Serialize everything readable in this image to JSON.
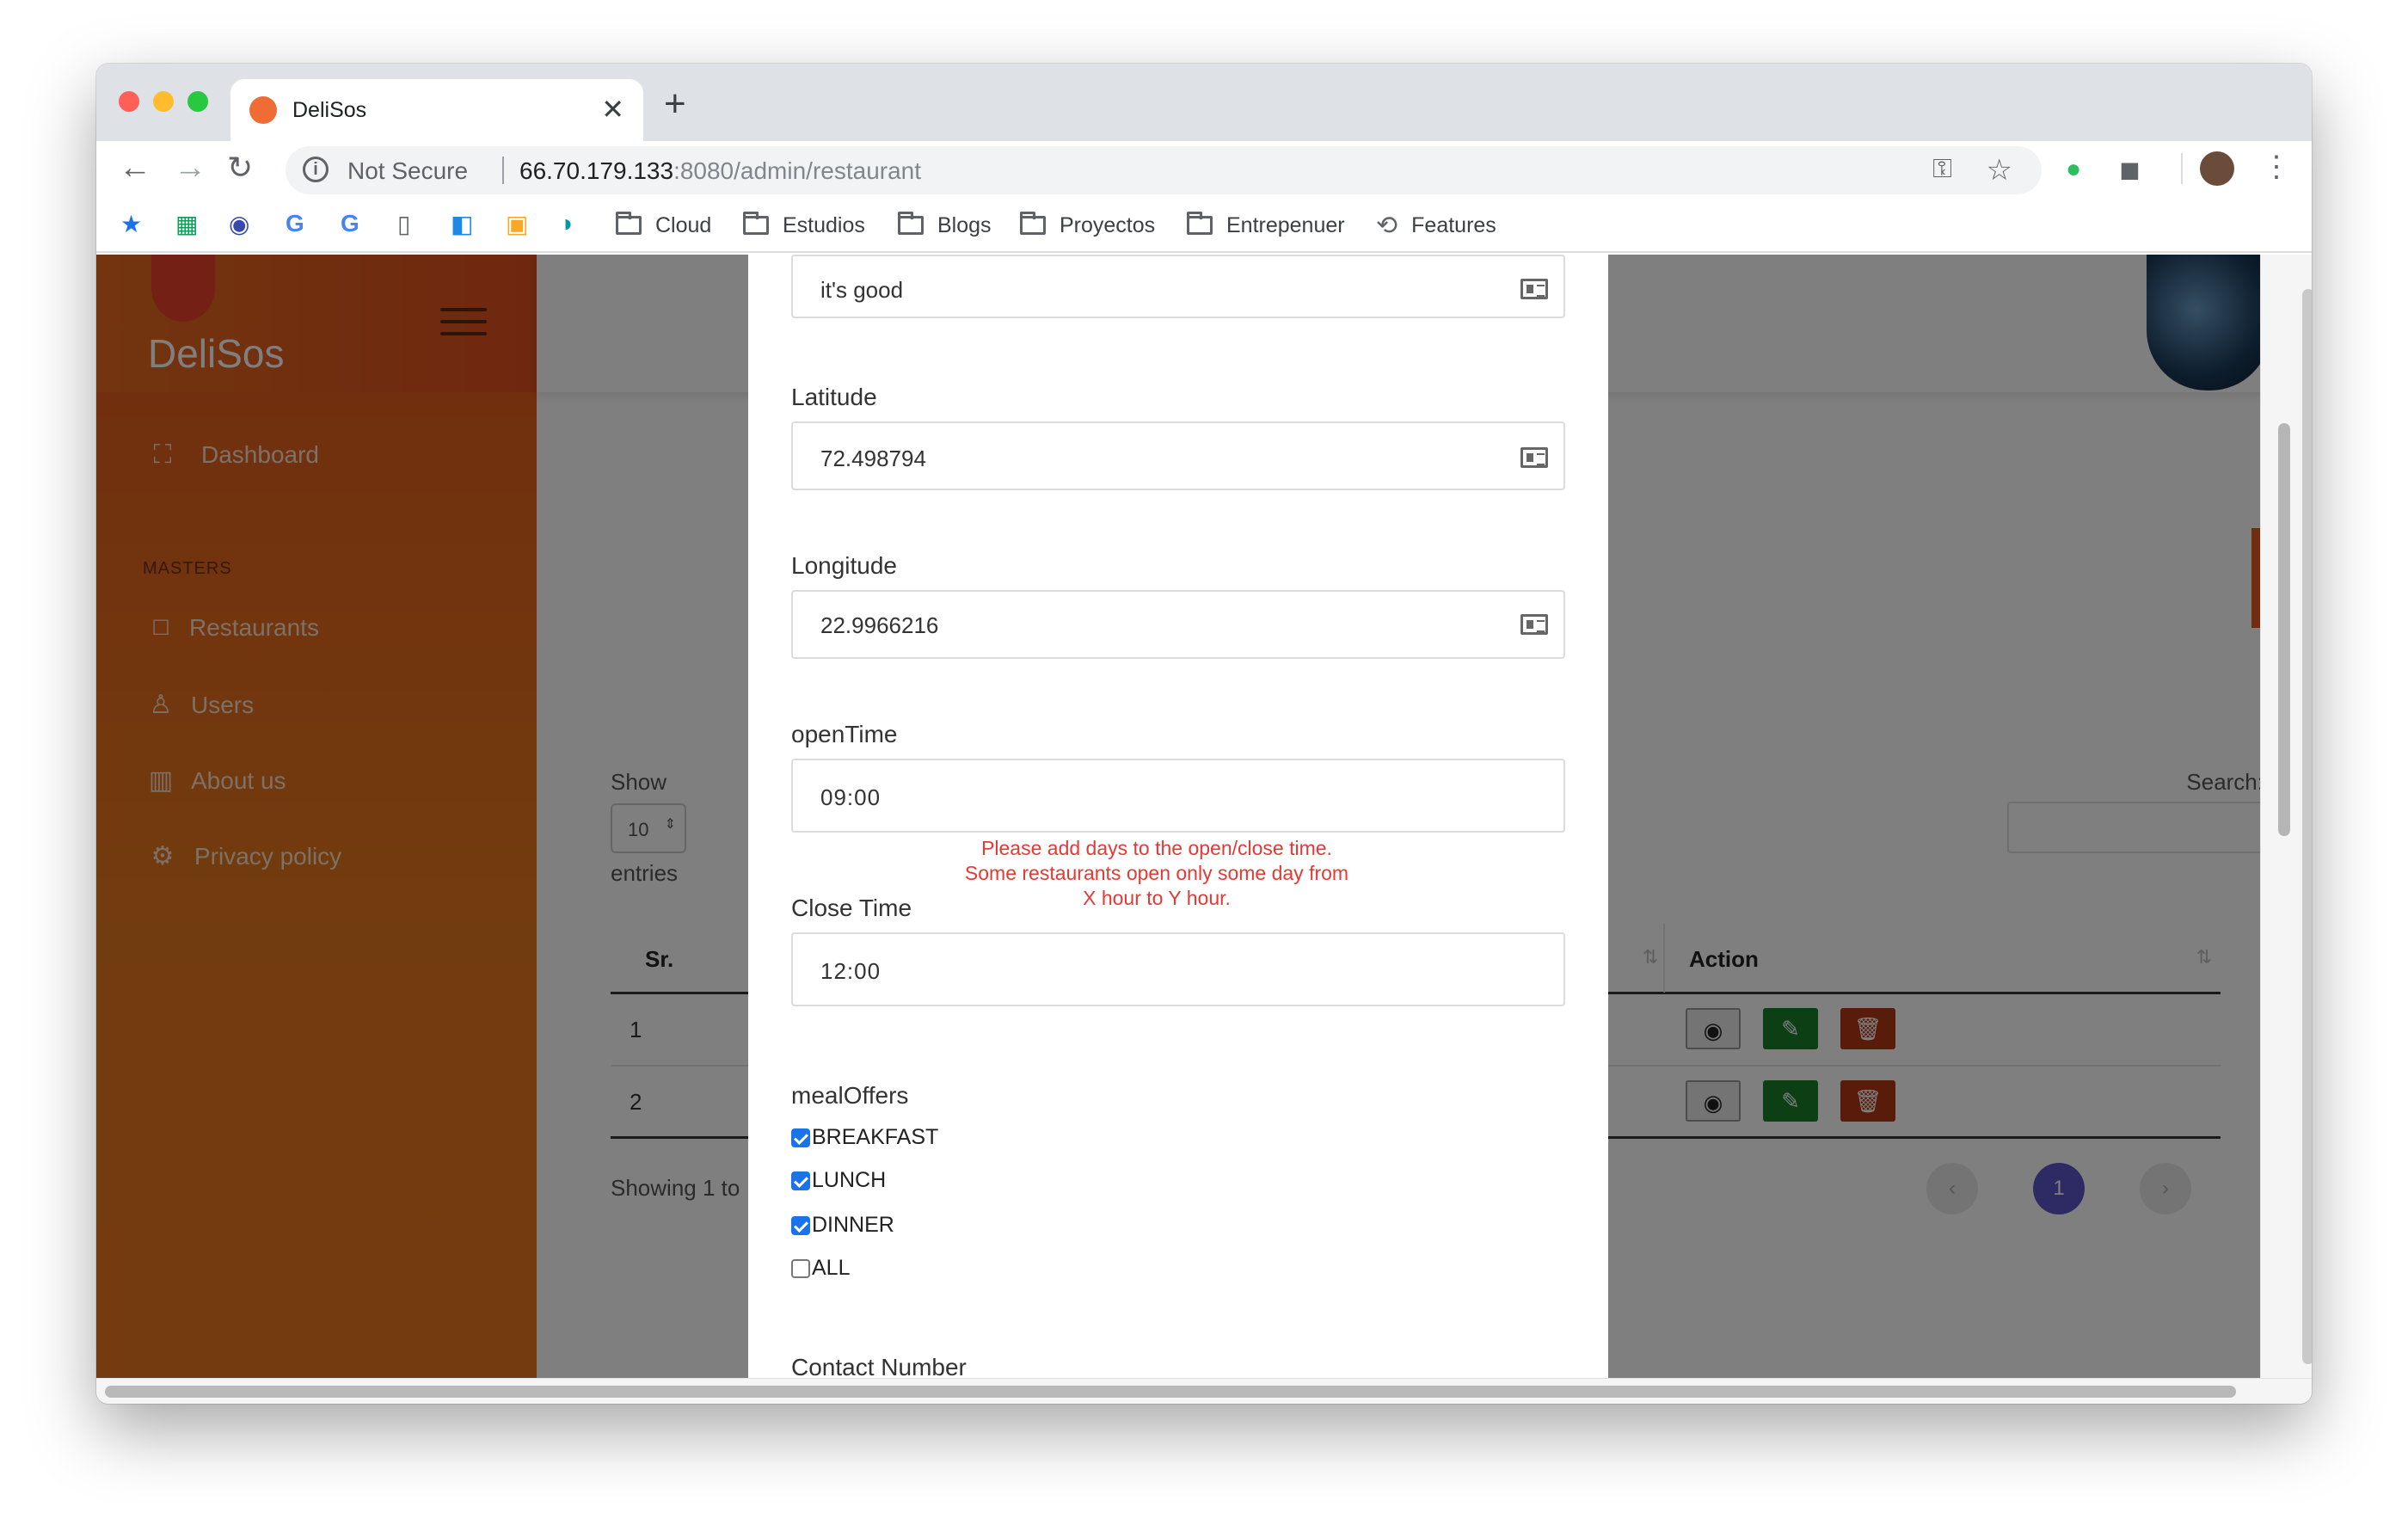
{
  "browser": {
    "tab_title": "DeliSos",
    "url_security": "Not Secure",
    "url_host": "66.70.179.133",
    "url_path": ":8080/admin/restaurant",
    "bookmarks": {
      "cloud": "Cloud",
      "estudios": "Estudios",
      "blogs": "Blogs",
      "proyectos": "Proyectos",
      "entrepenuer": "Entrepenuer",
      "features": "Features"
    }
  },
  "sidebar": {
    "brand": "DeliSos",
    "dashboard": "Dashboard",
    "section": "MASTERS",
    "restaurants": "Restaurants",
    "users": "Users",
    "about": "About us",
    "privacy": "Privacy policy"
  },
  "table_view": {
    "show_label": "Show",
    "entries_value": "10",
    "entries_label": "entries",
    "search_label": "Search:",
    "col_sr": "Sr.",
    "col_action": "Action",
    "rows": [
      {
        "sr": "1"
      },
      {
        "sr": "2"
      }
    ],
    "showing": "Showing 1 to",
    "page_prev": "‹",
    "page_current": "1",
    "page_next": "›"
  },
  "modal": {
    "description_value": "it's good",
    "latitude_label": "Latitude",
    "latitude_value": "72.498794",
    "longitude_label": "Longitude",
    "longitude_value": "22.9966216",
    "open_time_label": "openTime",
    "open_time_value": "09:00",
    "note": "Please add days to the open/close time. Some restaurants open only some day from X hour to Y hour.",
    "close_time_label": "Close Time",
    "close_time_value": "12:00",
    "meal_label": "mealOffers",
    "meals": {
      "breakfast": "BREAKFAST",
      "lunch": "LUNCH",
      "dinner": "DINNER",
      "all": "ALL"
    },
    "contact_label": "Contact Number"
  },
  "colors": {
    "sidebar_orange": "#e2571e",
    "note_red": "#e53935",
    "pagination_active": "#3f3a9e",
    "view_btn": "#4a4a4a",
    "edit_btn": "#1a7f2b",
    "delete_btn": "#8e2a12"
  }
}
